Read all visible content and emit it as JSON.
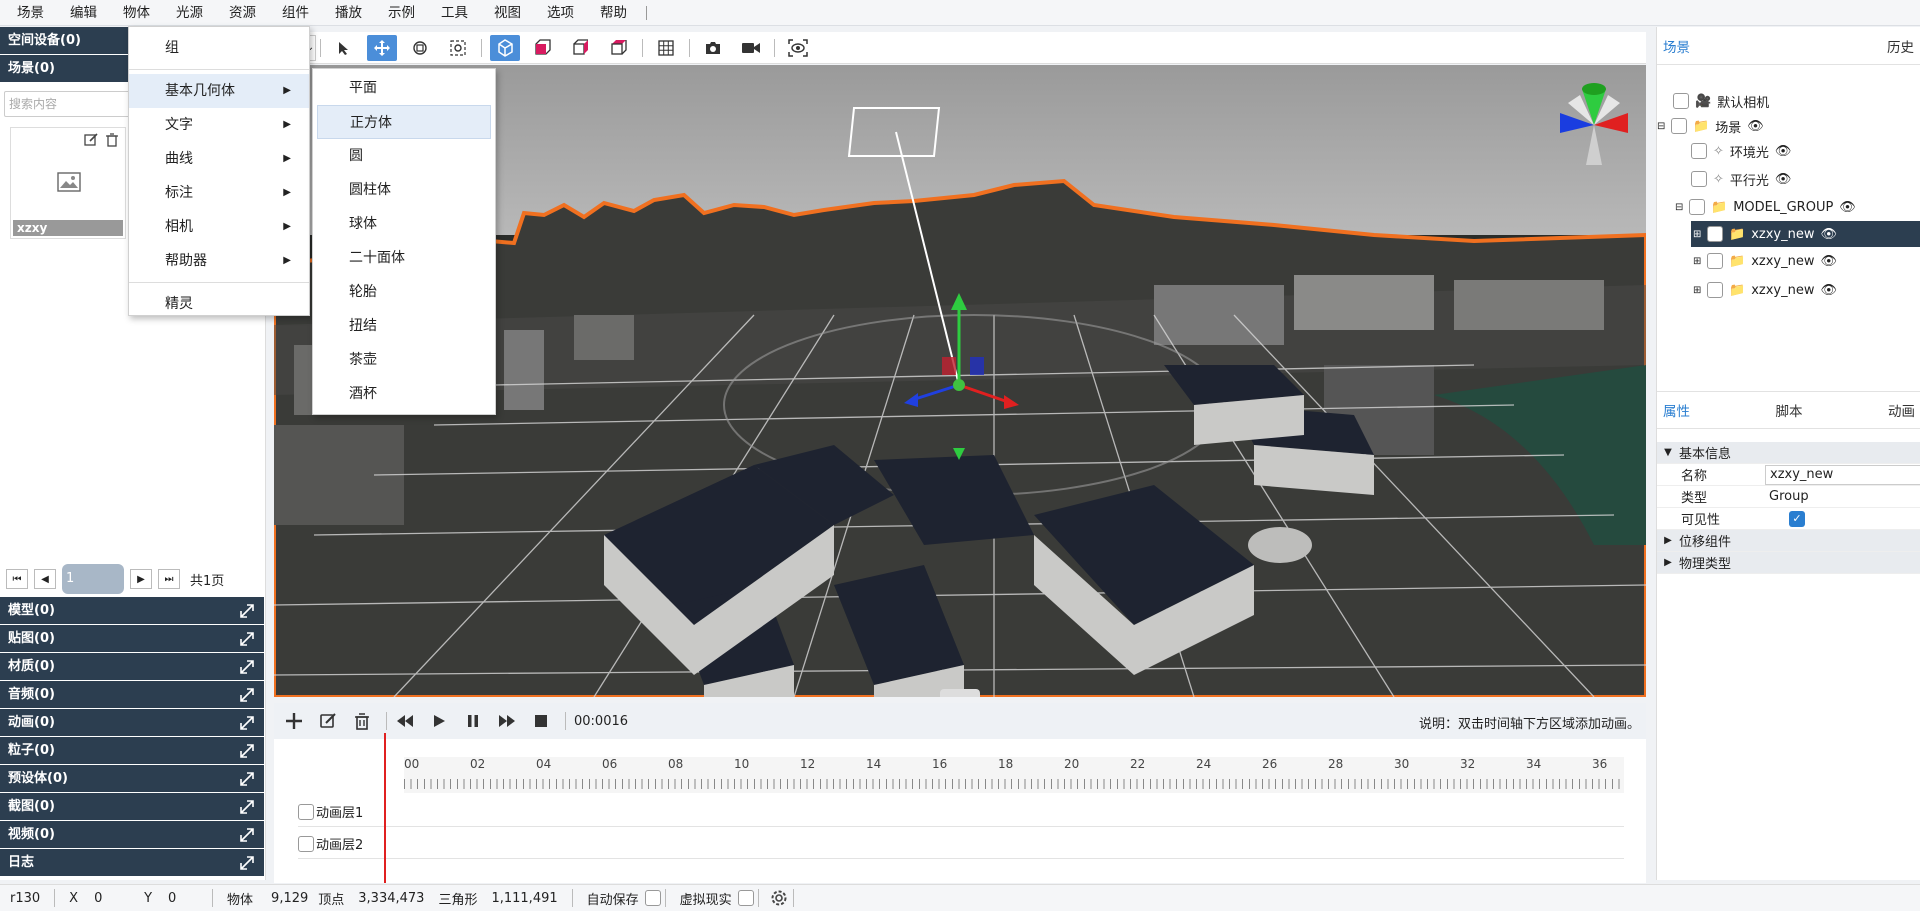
{
  "menubar": {
    "items": [
      "场景",
      "编辑",
      "物体",
      "光源",
      "资源",
      "组件",
      "播放",
      "示例",
      "工具",
      "视图",
      "选项",
      "帮助"
    ]
  },
  "left": {
    "space_devices": "空间设备(0)",
    "scene": "场景(0)",
    "search_placeholder": "搜索内容",
    "asset_name": "xzxy",
    "page_value": "1",
    "page_total": "共1页",
    "sections": [
      "模型(0)",
      "贴图(0)",
      "材质(0)",
      "音频(0)",
      "动画(0)",
      "粒子(0)",
      "预设体(0)",
      "截图(0)",
      "视频(0)",
      "日志"
    ]
  },
  "toolbar": {
    "partial_label": "工具"
  },
  "menu_object": {
    "items": [
      "组",
      "基本几何体",
      "文字",
      "曲线",
      "标注",
      "相机",
      "帮助器",
      "精灵"
    ]
  },
  "menu_geometry": {
    "items": [
      "平面",
      "正方体",
      "圆",
      "圆柱体",
      "球体",
      "二十面体",
      "轮胎",
      "扭结",
      "茶壶",
      "酒杯"
    ],
    "highlighted": "正方体"
  },
  "timeline": {
    "time": "00:0016",
    "note": "说明：双击时间轴下方区域添加动画。",
    "ticks": [
      "00",
      "02",
      "04",
      "06",
      "08",
      "10",
      "12",
      "14",
      "16",
      "18",
      "20",
      "22",
      "24",
      "26",
      "28",
      "30",
      "32",
      "34",
      "36"
    ],
    "layers": [
      "动画层1",
      "动画层2"
    ]
  },
  "right": {
    "tab_scene": "场景",
    "tab_history": "历史",
    "tree": [
      "默认相机",
      "场景",
      "环境光",
      "平行光",
      "MODEL_GROUP",
      "xzxy_new",
      "xzxy_new",
      "xzxy_new"
    ],
    "prop_tabs": [
      "属性",
      "脚本",
      "动画"
    ],
    "group_basic": "基本信息",
    "name_label": "名称",
    "name_value": "xzxy_new",
    "type_label": "类型",
    "type_value": "Group",
    "visible_label": "可见性",
    "group_offset": "位移组件",
    "group_physics": "物理类型"
  },
  "status": {
    "version": "r130",
    "x_label": "X",
    "x_value": "0",
    "y_label": "Y",
    "y_value": "0",
    "objects_label": "物体",
    "objects_value": "9,129",
    "vertices_label": "顶点",
    "vertices_value": "3,334,473",
    "triangles_label": "三角形",
    "triangles_value": "1,111,491",
    "autosave": "自动保存",
    "vr": "虚拟现实"
  },
  "colors": {
    "accent": "#2c3e50",
    "tool_active": "#4b8ed9",
    "outline": "#f07020",
    "playhead": "#e02020"
  }
}
